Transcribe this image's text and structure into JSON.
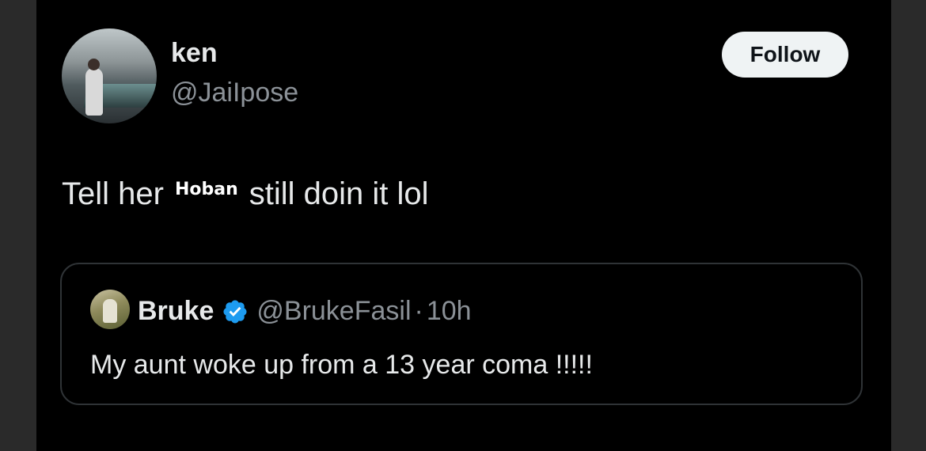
{
  "author": {
    "display_name": "ken",
    "handle": "@JaiIpose",
    "avatar_icon": "user-avatar"
  },
  "follow_button": {
    "label": "Follow"
  },
  "tweet": {
    "text_before": "Tell her",
    "overlay_name": "Hoban",
    "text_after": "still doin it lol"
  },
  "quoted": {
    "display_name": "Bruke",
    "verified_icon": "verified-badge-icon",
    "handle": "@BrukeFasil",
    "separator": "·",
    "time": "10h",
    "text": "My aunt woke up from a 13 year coma !!!!!"
  },
  "colors": {
    "background": "#000000",
    "text_primary": "#e7e9ea",
    "text_secondary": "#8b9197",
    "verified": "#1d9bf0",
    "button_bg": "#eff3f4"
  }
}
